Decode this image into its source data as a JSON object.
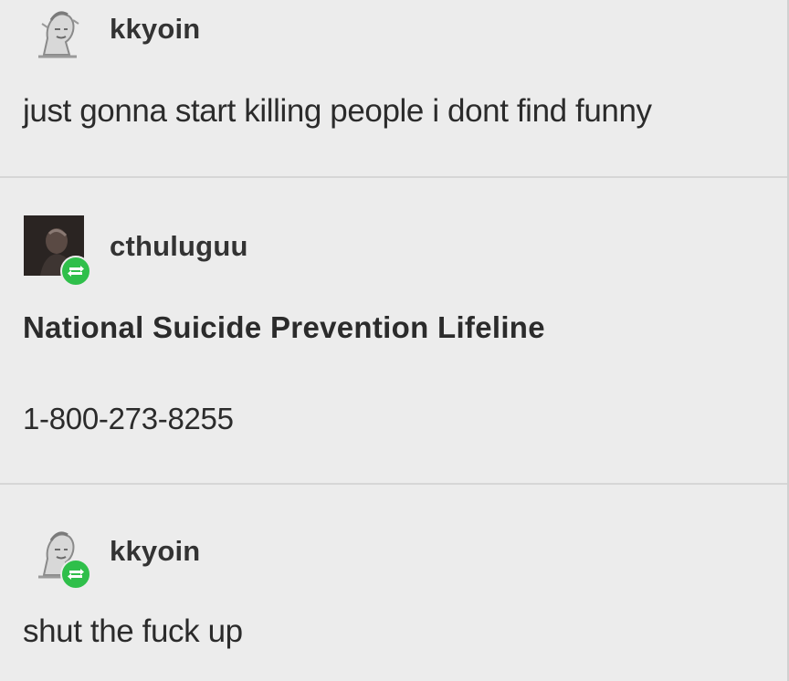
{
  "posts": [
    {
      "username": "kkyoin",
      "avatar": "sketch-avatar-icon",
      "text": "just gonna start killing people i dont find funny"
    },
    {
      "username": "cthuluguu",
      "avatar": "dark-photo-avatar-icon",
      "heading": "National Suicide Prevention Lifeline",
      "text": "1-800-273-8255"
    },
    {
      "username": "kkyoin",
      "avatar": "sketch-avatar-icon",
      "text": "shut the fuck up"
    }
  ],
  "colors": {
    "background": "#ececec",
    "divider": "#d6d6d6",
    "follow_badge": "#2fbf4a"
  }
}
